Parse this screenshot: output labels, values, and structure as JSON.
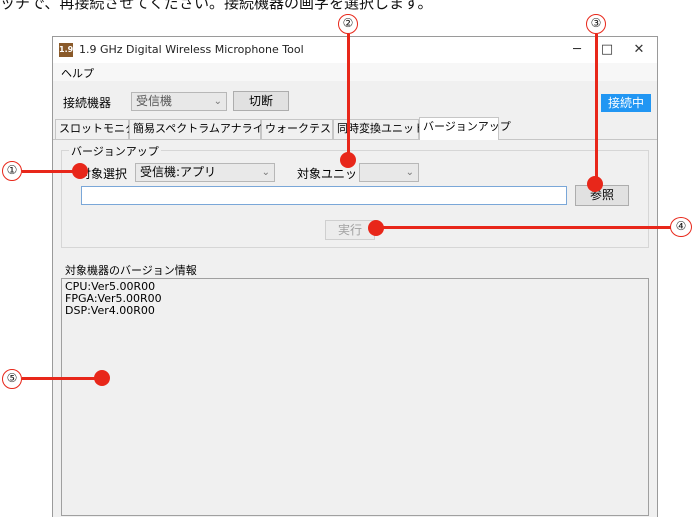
{
  "header_text": "ッチで、再接続させてください。接続機器の画字を選択します。",
  "window": {
    "title": "1.9 GHz Digital Wireless Microphone Tool",
    "icon_text": "1.9",
    "minimize": "─",
    "maximize": "□",
    "close": "✕"
  },
  "menu": {
    "help": "ヘルプ"
  },
  "connection": {
    "label": "接続機器",
    "device_value": "受信機",
    "disconnect_label": "切断",
    "status_label": "接続中",
    "status_color": "#2196f3"
  },
  "tabs": [
    "スロットモニター",
    "簡易スペクトラムアナライザー",
    "ウォークテスト",
    "同時変換ユニット",
    "バージョンアップ"
  ],
  "version_up": {
    "group_title": "バージョンアップ",
    "target_label": "対象選択",
    "target_value": "受信機:アプリ",
    "unit_label": "対象ユニット",
    "unit_value": "",
    "file_path": "",
    "browse_label": "参照",
    "execute_label": "実行"
  },
  "version_info": {
    "label": "対象機器のバージョン情報",
    "lines": [
      "CPU:Ver5.00R00",
      "FPGA:Ver5.00R00",
      "DSP:Ver4.00R00"
    ]
  },
  "callouts": [
    "①",
    "②",
    "③",
    "④",
    "⑤"
  ],
  "accent_color": "#e8271a"
}
